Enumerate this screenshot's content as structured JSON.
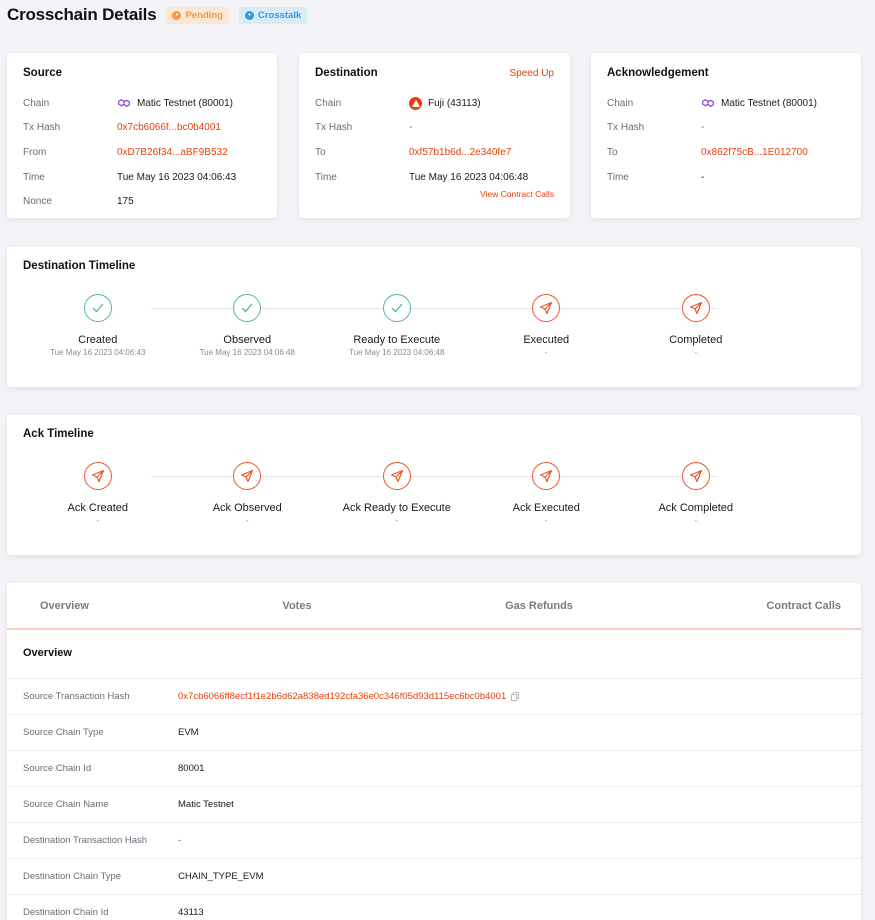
{
  "header": {
    "title": "Crosschain Details",
    "status_badge": "Pending",
    "protocol_badge": "Crosstalk"
  },
  "source": {
    "title": "Source",
    "rows": [
      {
        "label": "Chain",
        "value": "Matic Testnet (80001)"
      },
      {
        "label": "Tx Hash",
        "value": "0x7cb6066f...bc0b4001"
      },
      {
        "label": "From",
        "value": "0xD7B26f34...aBF9B532"
      },
      {
        "label": "Time",
        "value": "Tue May 16 2023 04:06:43"
      },
      {
        "label": "Nonce",
        "value": "175"
      }
    ]
  },
  "destination": {
    "title": "Destination",
    "speed_up": "Speed Up",
    "view_contract_calls": "View Contract Calls",
    "rows": [
      {
        "label": "Chain",
        "value": "Fuji (43113)"
      },
      {
        "label": "Tx Hash",
        "value": "-"
      },
      {
        "label": "To",
        "value": "0xf57b1b6d...2e340fe7"
      },
      {
        "label": "Time",
        "value": "Tue May 16 2023 04:06:48"
      }
    ]
  },
  "acknowledgement": {
    "title": "Acknowledgement",
    "rows": [
      {
        "label": "Chain",
        "value": "Matic Testnet (80001)"
      },
      {
        "label": "Tx Hash",
        "value": "-"
      },
      {
        "label": "To",
        "value": "0x862f75cB...1E012700"
      },
      {
        "label": "Time",
        "value": "-"
      }
    ]
  },
  "destination_timeline": {
    "title": "Destination Timeline",
    "steps": [
      {
        "label": "Created",
        "time": "Tue May 16 2023 04:06:43",
        "status": "done"
      },
      {
        "label": "Observed",
        "time": "Tue May 16 2023 04:06:48",
        "status": "done"
      },
      {
        "label": "Ready to Execute",
        "time": "Tue May 16 2023 04:06:48",
        "status": "done"
      },
      {
        "label": "Executed",
        "time": "-",
        "status": "pending"
      },
      {
        "label": "Completed",
        "time": "-",
        "status": "pending"
      }
    ]
  },
  "ack_timeline": {
    "title": "Ack Timeline",
    "steps": [
      {
        "label": "Ack Created",
        "time": "-",
        "status": "pending"
      },
      {
        "label": "Ack Observed",
        "time": "-",
        "status": "pending"
      },
      {
        "label": "Ack Ready to Execute",
        "time": "-",
        "status": "pending"
      },
      {
        "label": "Ack Executed",
        "time": "-",
        "status": "pending"
      },
      {
        "label": "Ack Completed",
        "time": "-",
        "status": "pending"
      }
    ]
  },
  "tabs": [
    "Overview",
    "Votes",
    "Gas Refunds",
    "Contract Calls"
  ],
  "overview": {
    "title": "Overview",
    "rows": [
      {
        "label": "Source Transaction Hash",
        "value": "0x7cb6066ff8ecf1f1e2b6d62a838ed192cfa36e0c346f05d93d115ec6bc0b4001"
      },
      {
        "label": "Source Chain Type",
        "value": "EVM"
      },
      {
        "label": "Source Chain Id",
        "value": "80001"
      },
      {
        "label": "Source Chain Name",
        "value": "Matic Testnet"
      },
      {
        "label": "Destination Transaction Hash",
        "value": "-"
      },
      {
        "label": "Destination Chain Type",
        "value": "CHAIN_TYPE_EVM"
      },
      {
        "label": "Destination Chain Id",
        "value": "43113"
      }
    ]
  },
  "colors": {
    "accent": "#e8400c",
    "done": "#55b3a8",
    "pending_badge": "#f2994a",
    "crosstalk_badge": "#3b96d6"
  }
}
